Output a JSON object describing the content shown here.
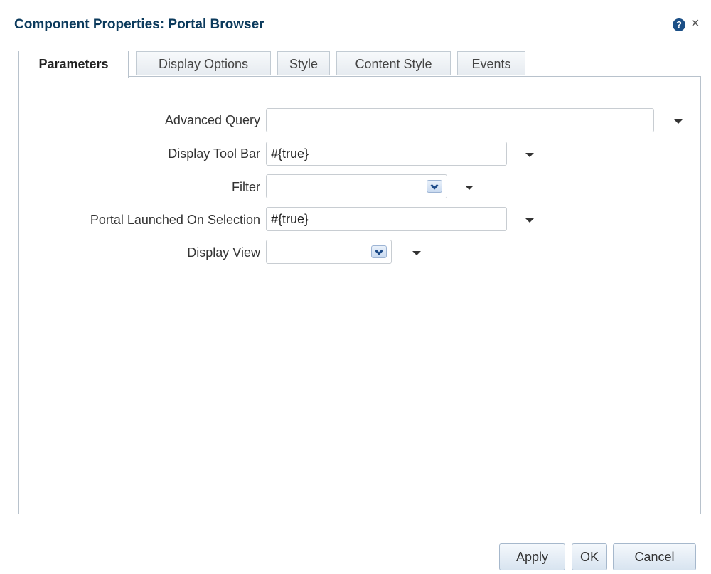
{
  "dialog": {
    "title": "Component Properties: Portal Browser",
    "help_icon": "?",
    "close_icon": "×"
  },
  "tabs": [
    {
      "label": "Parameters",
      "active": true
    },
    {
      "label": "Display Options",
      "active": false
    },
    {
      "label": "Style",
      "active": false
    },
    {
      "label": "Content Style",
      "active": false
    },
    {
      "label": "Events",
      "active": false
    }
  ],
  "form": {
    "advanced_query": {
      "label": "Advanced Query",
      "value": ""
    },
    "display_tool_bar": {
      "label": "Display Tool Bar",
      "value": "#{true}"
    },
    "filter": {
      "label": "Filter",
      "value": ""
    },
    "portal_launched_on_selection": {
      "label": "Portal Launched On Selection",
      "value": "#{true}"
    },
    "display_view": {
      "label": "Display View",
      "value": ""
    }
  },
  "buttons": {
    "apply": "Apply",
    "ok": "OK",
    "cancel": "Cancel"
  },
  "colors": {
    "title": "#0b3a5c",
    "help_icon_bg": "#1b4f86",
    "border": "#b8c2cc"
  }
}
